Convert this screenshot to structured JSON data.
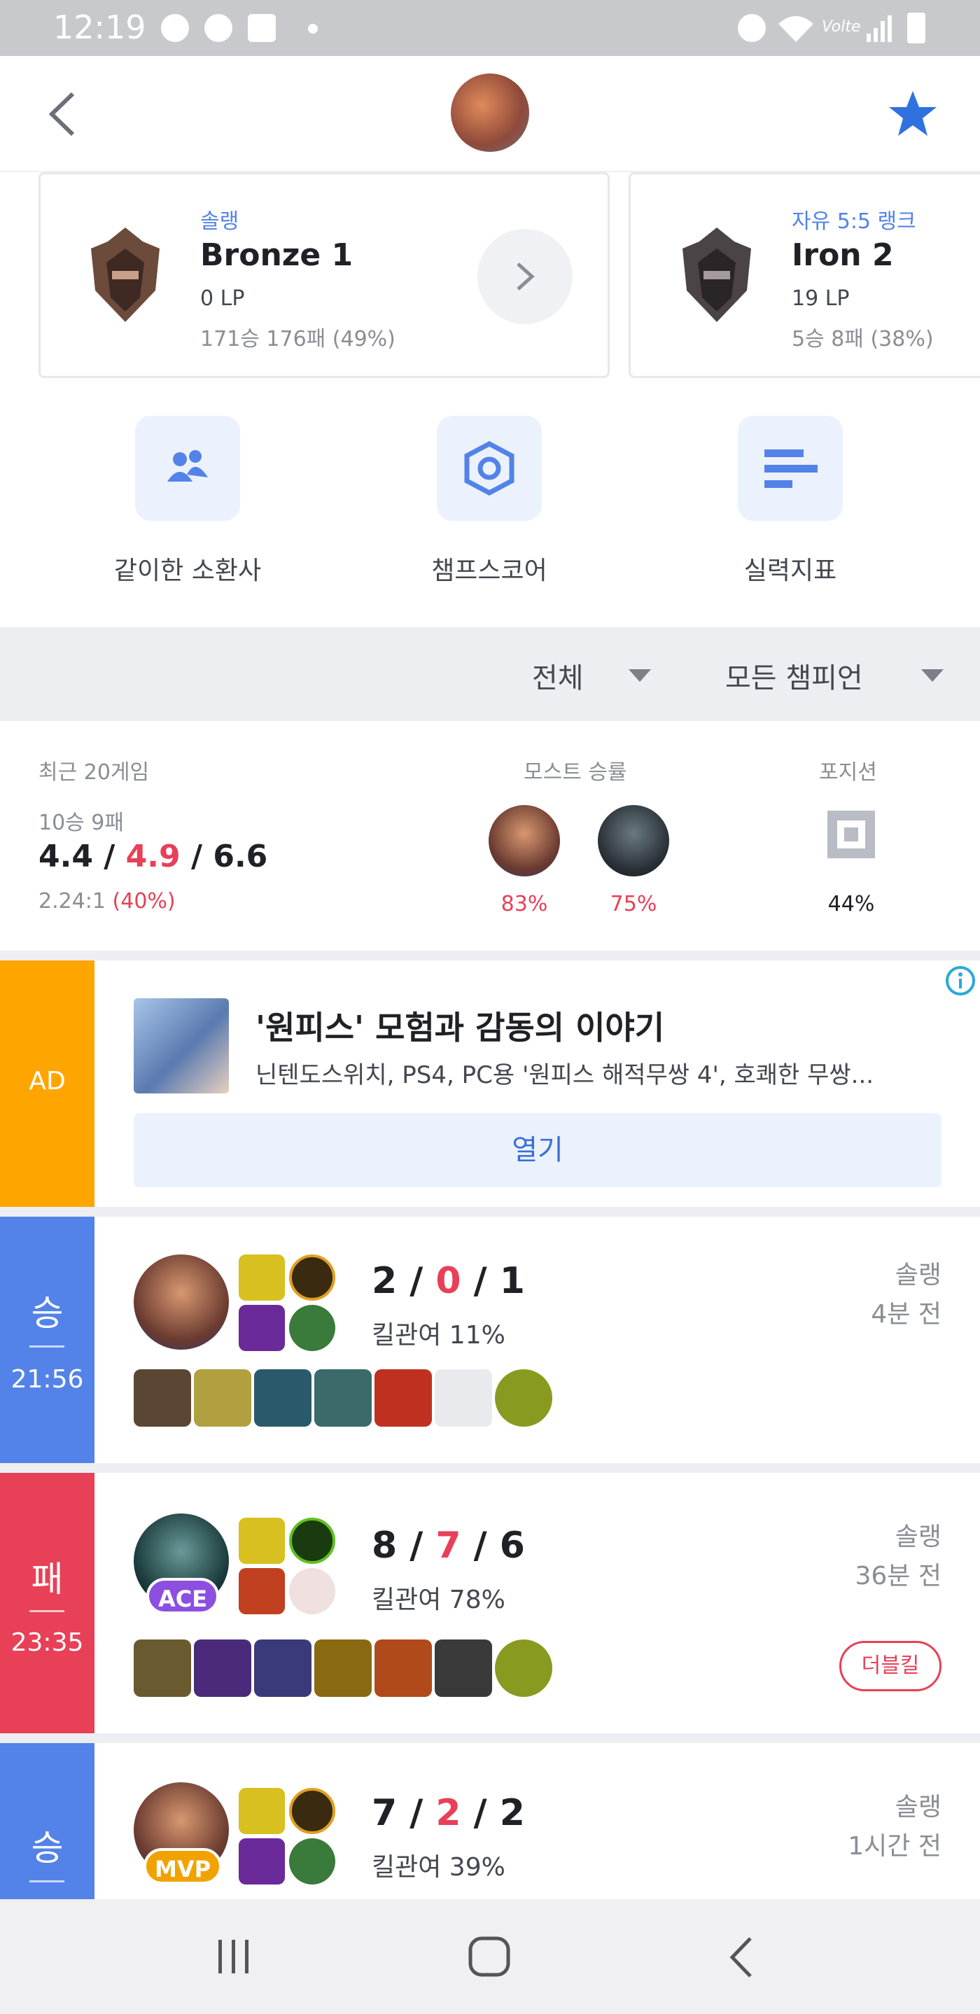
{
  "status_bar": {
    "time": "12:19",
    "icons_left": [
      "talk-icon",
      "n-icon",
      "mail-icon",
      "dot-icon"
    ],
    "icons_right": [
      "alarm-icon",
      "wifi-icon",
      "volte-icon",
      "signal-icon",
      "battery-icon"
    ]
  },
  "header": {
    "back_icon": "chevron-left-icon",
    "favorite_icon": "star-icon",
    "avatar": "profile-avatar"
  },
  "rank_cards": [
    {
      "queue": "솔랭",
      "tier": "Bronze 1",
      "lp": "0 LP",
      "record": "171승 176패 (49%)"
    },
    {
      "queue": "자유 5:5 랭크",
      "tier": "Iron 2",
      "lp": "19 LP",
      "record": "5승 8패 (38%)"
    }
  ],
  "shortcuts": [
    {
      "label": "같이한 소환사",
      "icon": "people-icon"
    },
    {
      "label": "챔프스코어",
      "icon": "hexagon-icon"
    },
    {
      "label": "실력지표",
      "icon": "bars-icon"
    }
  ],
  "filters": {
    "queue": "전체",
    "champion": "모든 챔피언"
  },
  "summary": {
    "recent_label": "최근 20게임",
    "record": "10승 9패",
    "kills": "4.4",
    "deaths": "4.9",
    "assists": "6.6",
    "ratio": "2.24:1",
    "ratio_pct": "(40%)",
    "most_label": "모스트 승률",
    "most": [
      {
        "winrate": "83%",
        "champion_icon": "champion-garen-icon"
      },
      {
        "winrate": "75%",
        "champion_icon": "champion-darius-icon"
      }
    ],
    "position_label": "포지션",
    "position_pct": "44%",
    "position_icon": "position-icon"
  },
  "ad": {
    "tag": "AD",
    "title": "'원피스' 모험과 감동의 이야기",
    "desc": "닌텐도스위치, PS4, PC용 '원피스 해적무쌍 4', 호쾌한 무쌍...",
    "button": "열기",
    "info_icon": "info-icon"
  },
  "games": [
    {
      "result": "승",
      "duration": "21:56",
      "kills": "2",
      "deaths": "0",
      "assists": "1",
      "kp": "킬관여 11%",
      "queue": "솔랭",
      "ago": "4분 전",
      "badge": "",
      "multikill": "",
      "color": "#5383e8"
    },
    {
      "result": "패",
      "duration": "23:35",
      "kills": "8",
      "deaths": "7",
      "assists": "6",
      "kp": "킬관여 78%",
      "queue": "솔랭",
      "ago": "36분 전",
      "badge": "ACE",
      "multikill": "더블킬",
      "color": "#e84057"
    },
    {
      "result": "승",
      "duration": "",
      "kills": "7",
      "deaths": "2",
      "assists": "2",
      "kp": "킬관여 39%",
      "queue": "솔랭",
      "ago": "1시간 전",
      "badge": "MVP",
      "multikill": "",
      "color": "#5383e8"
    }
  ],
  "nav": {
    "recent_icon": "recent-apps-icon",
    "home_icon": "home-icon",
    "back_icon": "back-icon"
  }
}
